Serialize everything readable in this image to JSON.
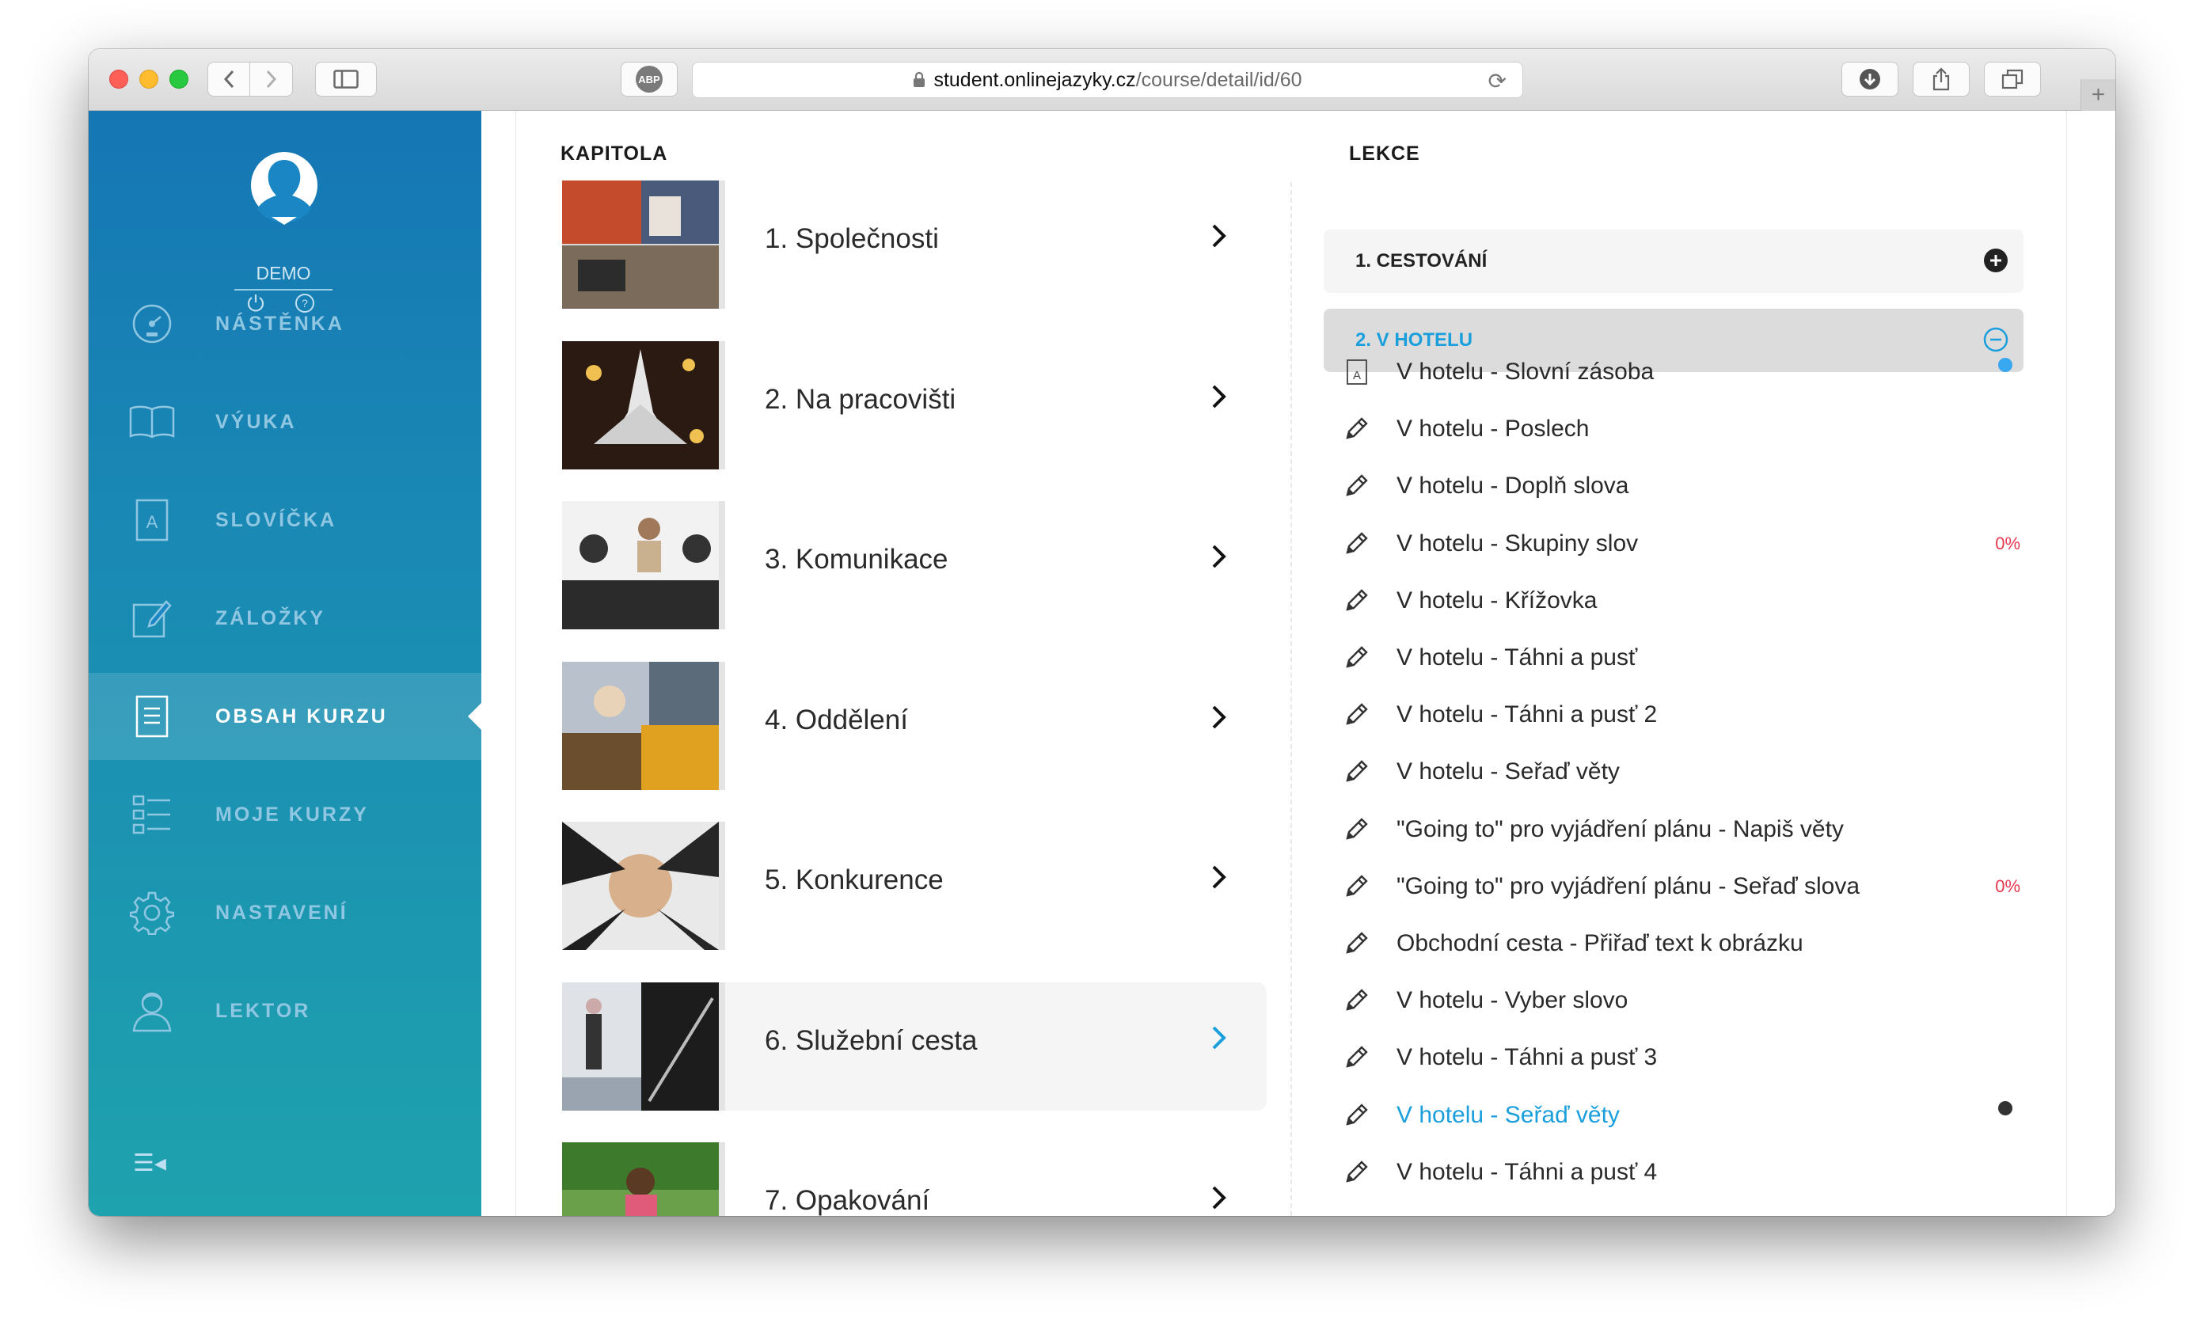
{
  "browser": {
    "url_host": "student.onlinejazyky.cz",
    "url_path": "/course/detail/id/60",
    "adblock_label": "ABP"
  },
  "user": {
    "name": "DEMO"
  },
  "nav": [
    {
      "label": "NÁSTĚNKA",
      "icon": "dashboard-icon"
    },
    {
      "label": "VÝUKA",
      "icon": "book-icon"
    },
    {
      "label": "SLOVÍČKA",
      "icon": "vocabulary-icon"
    },
    {
      "label": "ZÁLOŽKY",
      "icon": "bookmark-edit-icon"
    },
    {
      "label": "OBSAH KURZU",
      "icon": "document-icon",
      "active": true
    },
    {
      "label": "MOJE KURZY",
      "icon": "list-icon"
    },
    {
      "label": "NASTAVENÍ",
      "icon": "gear-icon"
    },
    {
      "label": "LEKTOR",
      "icon": "tutor-icon"
    }
  ],
  "headers": {
    "chapters": "KAPITOLA",
    "lessons": "LEKCE"
  },
  "chapters": [
    {
      "title": "1. Společnosti"
    },
    {
      "title": "2. Na pracovišti"
    },
    {
      "title": "3. Komunikace"
    },
    {
      "title": "4. Oddělení"
    },
    {
      "title": "5. Konkurence"
    },
    {
      "title": "6. Služební cesta",
      "selected": true
    },
    {
      "title": "7. Opakování"
    }
  ],
  "lesson_groups": [
    {
      "title": "1. CESTOVÁNÍ",
      "open": false
    },
    {
      "title": "2. V HOTELU",
      "open": true
    }
  ],
  "lessons": [
    {
      "title": "V hotelu - Slovní zásoba",
      "icon": "vocabulary-card-icon",
      "status": "blue-dot"
    },
    {
      "title": "V hotelu - Poslech",
      "icon": "pencil-icon"
    },
    {
      "title": "V hotelu - Doplň slova",
      "icon": "pencil-icon"
    },
    {
      "title": "V hotelu - Skupiny slov",
      "icon": "pencil-icon",
      "percent": "0%"
    },
    {
      "title": "V hotelu - Křížovka",
      "icon": "pencil-icon"
    },
    {
      "title": "V hotelu - Táhni a pusť",
      "icon": "pencil-icon"
    },
    {
      "title": "V hotelu - Táhni a pusť 2",
      "icon": "pencil-icon"
    },
    {
      "title": "V hotelu - Seřaď věty",
      "icon": "pencil-icon"
    },
    {
      "title": "\"Going to\" pro vyjádření plánu - Napiš věty",
      "icon": "pencil-icon"
    },
    {
      "title": "\"Going to\" pro vyjádření plánu - Seřaď slova",
      "icon": "pencil-icon",
      "percent": "0%"
    },
    {
      "title": "Obchodní cesta - Přiřaď text k obrázku",
      "icon": "pencil-icon"
    },
    {
      "title": "V hotelu - Vyber slovo",
      "icon": "pencil-icon"
    },
    {
      "title": "V hotelu - Táhni a pusť 3",
      "icon": "pencil-icon"
    },
    {
      "title": "V hotelu - Seřaď věty",
      "icon": "pencil-icon",
      "current": true,
      "status": "dark-dot"
    },
    {
      "title": "V hotelu - Táhni a pusť 4",
      "icon": "pencil-icon"
    }
  ],
  "colors": {
    "accent": "#1a9fdc",
    "sidebar_top": "#1576b4",
    "sidebar_bottom": "#1ea2ad",
    "percent_red": "#e53950",
    "dot_blue": "#3aa8f0",
    "dot_dark": "#333333"
  }
}
